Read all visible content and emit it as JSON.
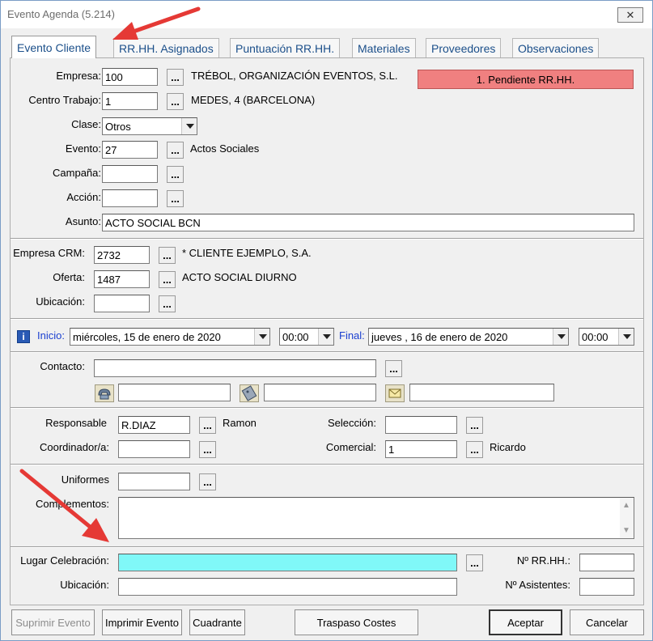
{
  "window": {
    "title": "Evento Agenda (5.214)",
    "close_label": "✕"
  },
  "tabs": [
    {
      "label": "Evento Cliente"
    },
    {
      "label": "RR.HH. Asignados"
    },
    {
      "label": "Puntuación RR.HH."
    },
    {
      "label": "Materiales"
    },
    {
      "label": "Proveedores"
    },
    {
      "label": "Observaciones"
    }
  ],
  "status_button": "1. Pendiente RR.HH.",
  "dots_label": "...",
  "form": {
    "empresa": {
      "label": "Empresa:",
      "value": "100",
      "desc": "TRÉBOL, ORGANIZACIÓN EVENTOS, S.L."
    },
    "centro": {
      "label": "Centro Trabajo:",
      "value": "1",
      "desc": "MEDES, 4 (BARCELONA)"
    },
    "clase": {
      "label": "Clase:",
      "value": "Otros"
    },
    "evento": {
      "label": "Evento:",
      "value": "27",
      "desc": "Actos Sociales"
    },
    "campana": {
      "label": "Campaña:",
      "value": ""
    },
    "accion": {
      "label": "Acción:",
      "value": ""
    },
    "asunto": {
      "label": "Asunto:",
      "value": "ACTO SOCIAL BCN"
    },
    "empresa_crm": {
      "label": "Empresa CRM:",
      "value": "2732",
      "desc": "* CLIENTE EJEMPLO, S.A."
    },
    "oferta": {
      "label": "Oferta:",
      "value": "1487",
      "desc": "ACTO SOCIAL DIURNO"
    },
    "ubicacion": {
      "label": "Ubicación:",
      "value": ""
    },
    "inicio": {
      "label": "Inicio:",
      "date": "miércoles, 15 de     enero    de 2020",
      "time": "00:00"
    },
    "final": {
      "label": "Final:",
      "date": "jueves  , 16 de     enero    de 2020",
      "time": "00:00"
    },
    "contacto": {
      "label": "Contacto:",
      "value": ""
    },
    "responsable": {
      "label": "Responsable",
      "value": "R.DIAZ",
      "desc": "Ramon"
    },
    "seleccion": {
      "label": "Selección:",
      "value": ""
    },
    "coordinador": {
      "label": "Coordinador/a:",
      "value": ""
    },
    "comercial": {
      "label": "Comercial:",
      "value": "1",
      "desc": "Ricardo"
    },
    "uniformes": {
      "label": "Uniformes",
      "value": ""
    },
    "complementos": {
      "label": "Complementos:",
      "value": ""
    },
    "lugar": {
      "label": "Lugar Celebración:",
      "value": ""
    },
    "n_rrhh": {
      "label": "Nº RR.HH.:",
      "value": ""
    },
    "ubicacion2": {
      "label": "Ubicación:",
      "value": ""
    },
    "n_asistentes": {
      "label": "Nº Asistentes:",
      "value": ""
    }
  },
  "footer": {
    "suprimir": "Suprimir Evento",
    "imprimir": "Imprimir Evento",
    "cuadrante": "Cuadrante",
    "traspaso": "Traspaso Costes",
    "aceptar": "Aceptar",
    "cancelar": "Cancelar"
  },
  "colors": {
    "status_bg": "#f08080",
    "lugar_bg": "#80f8f8",
    "arrow": "#e53935",
    "tab_text": "#1b4f8a",
    "date_label": "#1a3fd0"
  },
  "icons": [
    "phone-icon",
    "fax-icon",
    "email-icon",
    "info-icon"
  ]
}
